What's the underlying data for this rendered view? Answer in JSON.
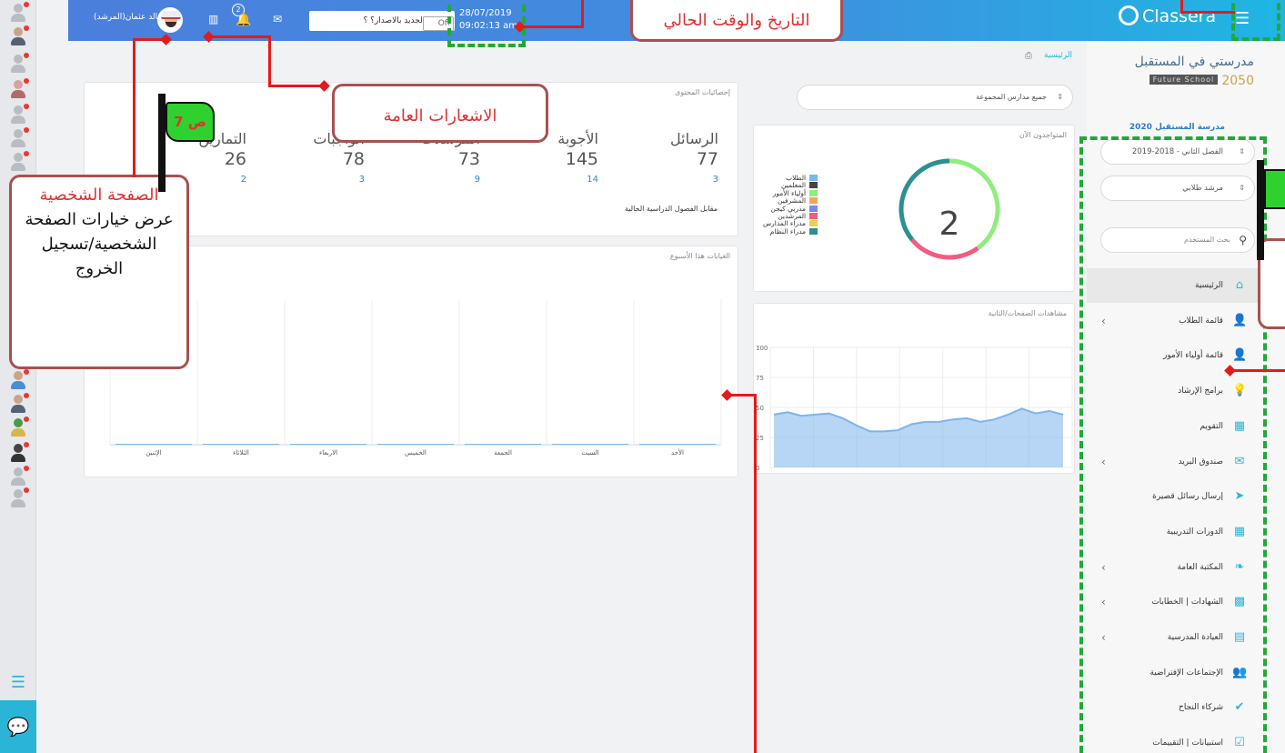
{
  "topbar": {
    "user_name": "خالد عثمان(المرشد)",
    "notification_count": "2",
    "whats_new": "ما هو الجديد بالاصدار؟ ؟",
    "toggle_off": "Off",
    "date": "28/07/2019",
    "time": "09:02:13 am",
    "brand": "Classera",
    "icons": [
      "user-avatar",
      "building-icon",
      "bell-icon",
      "mail-icon",
      "hamburger-icon"
    ]
  },
  "breadcrumb": {
    "home": "الرئيسية"
  },
  "school_filter": {
    "value": "جميع مدارس المجموعة"
  },
  "stats": {
    "title": "إحصائيات المحتوى",
    "items": [
      {
        "label": "الرسائل",
        "value": "77",
        "sub": "3"
      },
      {
        "label": "الأجوبة",
        "value": "145",
        "sub": "14"
      },
      {
        "label": "المرسلات",
        "value": "73",
        "sub": "9"
      },
      {
        "label": "الواجبات",
        "value": "78",
        "sub": "3"
      },
      {
        "label": "التمارين",
        "value": "26",
        "sub": "2"
      }
    ],
    "footer": "مقابل الفصول الدراسية الحالية"
  },
  "absences": {
    "title": "الغيابات هذا الأسبوع",
    "chart_data": {
      "type": "bar",
      "categories": [
        "الإثنين",
        "الثلاثاء",
        "الاربعاء",
        "الخميس",
        "الجمعة",
        "السبت",
        "الأحد"
      ],
      "values": [
        0,
        0,
        0,
        0,
        0,
        0,
        0
      ],
      "grid": true
    }
  },
  "online_now": {
    "title": "المتواجدون الآن",
    "count": "2",
    "legend": [
      {
        "label": "الطلاب",
        "color": "#7cb5ec"
      },
      {
        "label": "المعلمين",
        "color": "#434348"
      },
      {
        "label": "أولياء الأمور",
        "color": "#90ed7d"
      },
      {
        "label": "المشرفين",
        "color": "#f7a35c"
      },
      {
        "label": "مدربي كيجن",
        "color": "#8085e9"
      },
      {
        "label": "المرشدين",
        "color": "#f15c80"
      },
      {
        "label": "مدراء المدارس",
        "color": "#e4d354"
      },
      {
        "label": "مدراء النظام",
        "color": "#2b908f"
      }
    ],
    "chart_data": {
      "type": "pie",
      "series": [
        {
          "name": "أولياء الأمور",
          "value": 1,
          "color": "#90ed7d"
        },
        {
          "name": "المرشدين",
          "value": 0.6,
          "color": "#f15c80"
        },
        {
          "name": "مدراء النظام",
          "value": 0.9,
          "color": "#2b908f"
        }
      ]
    }
  },
  "page_views": {
    "title": "مشاهدات الصفحات/الثانية",
    "chart_data": {
      "type": "area",
      "ylim": [
        0,
        100
      ],
      "yticks": [
        "0",
        "25",
        "50",
        "75",
        "100"
      ],
      "values": [
        44,
        46,
        43,
        44,
        45,
        41,
        35,
        30,
        30,
        31,
        36,
        38,
        38,
        40,
        41,
        38,
        40,
        44,
        49,
        45,
        47,
        44
      ],
      "color": "#7cb5ec",
      "grid": true
    }
  },
  "sidebar": {
    "school_ar": "مدرستي في المستقبل",
    "school_en_tag": "Future School",
    "school_en_year": "2050",
    "school_year_name": "مدرسة المستقبل 2020",
    "semester": "الفصل الثاني - 2018-2019",
    "role": "مرشد طلابي",
    "search_placeholder": "بحث المستخدم",
    "menu": [
      {
        "label": "الرئيسية",
        "icon": "home-icon",
        "glyph": "⌂",
        "chevron": false,
        "active": true
      },
      {
        "label": "قائمة الطلاب",
        "icon": "user-icon",
        "glyph": "👤",
        "chevron": true
      },
      {
        "label": "قائمة أولياء الأمور",
        "icon": "user-icon",
        "glyph": "👤",
        "chevron": false
      },
      {
        "label": "برامج الإرشاد",
        "icon": "bulb-icon",
        "glyph": "💡",
        "chevron": false
      },
      {
        "label": "التقويم",
        "icon": "calendar-icon",
        "glyph": "▦",
        "chevron": false
      },
      {
        "label": "صندوق البريد",
        "icon": "mail-icon",
        "glyph": "✉",
        "chevron": true
      },
      {
        "label": "إرسال رسائل قصيرة",
        "icon": "send-icon",
        "glyph": "➤",
        "chevron": false
      },
      {
        "label": "الدورات التدريبية",
        "icon": "grid-icon",
        "glyph": "▦",
        "chevron": false
      },
      {
        "label": "المكتبة العامة",
        "icon": "leaf-icon",
        "glyph": "❧",
        "chevron": true
      },
      {
        "label": "الشهادات | الخطابات",
        "icon": "qr-icon",
        "glyph": "▩",
        "chevron": true
      },
      {
        "label": "العيادة المدرسية",
        "icon": "clipboard-icon",
        "glyph": "▤",
        "chevron": true
      },
      {
        "label": "الإجتماعات الإفتراضية",
        "icon": "users-icon",
        "glyph": "👥",
        "chevron": false
      },
      {
        "label": "شركاء النجاح",
        "icon": "check-icon",
        "glyph": "✔",
        "chevron": false
      },
      {
        "label": "استبيانات | التقييمات",
        "icon": "checkbox-icon",
        "glyph": "☑",
        "chevron": false
      }
    ]
  },
  "annotations": {
    "datetime_box": "التاريخ والوقت الحالي",
    "notifications_box": "الاشعارات العامة",
    "profile_title": "الصفحة الشخصية",
    "profile_body": "عرض خيارات الصفحة الشخصية/تسجيل الخروج",
    "flag_label": "ص 7"
  }
}
